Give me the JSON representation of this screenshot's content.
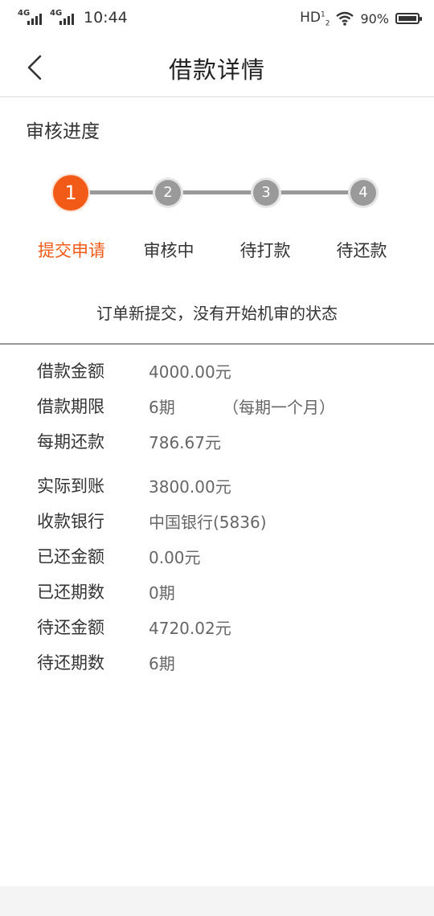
{
  "status_bar": {
    "net1": "4G",
    "net2": "4G",
    "time": "10:44",
    "hd": "HD",
    "hd_sup": "1",
    "hd_sub": "2",
    "battery": "90%"
  },
  "nav": {
    "title": "借款详情",
    "back_icon": "chevron-left-icon"
  },
  "progress": {
    "title": "审核进度",
    "active_color": "#f25a17",
    "inactive_color": "#9a9a9a",
    "current_step": 1,
    "steps": [
      {
        "num": "1",
        "label": "提交申请"
      },
      {
        "num": "2",
        "label": "审核中"
      },
      {
        "num": "3",
        "label": "待打款"
      },
      {
        "num": "4",
        "label": "待还款"
      }
    ],
    "status_text": "订单新提交，没有开始机审的状态"
  },
  "details": {
    "rows": [
      {
        "label": "借款金额",
        "value": "4000.00元"
      },
      {
        "label": "借款期限",
        "value": "6期",
        "note": "（每期一个月）"
      },
      {
        "label": "每期还款",
        "value": "786.67元"
      },
      {
        "label": "实际到账",
        "value": "3800.00元"
      },
      {
        "label": "收款银行",
        "value": "中国银行(5836)"
      },
      {
        "label": "已还金额",
        "value": "0.00元"
      },
      {
        "label": "已还期数",
        "value": "0期"
      },
      {
        "label": "待还金额",
        "value": "4720.02元"
      },
      {
        "label": "待还期数",
        "value": "6期"
      }
    ]
  }
}
